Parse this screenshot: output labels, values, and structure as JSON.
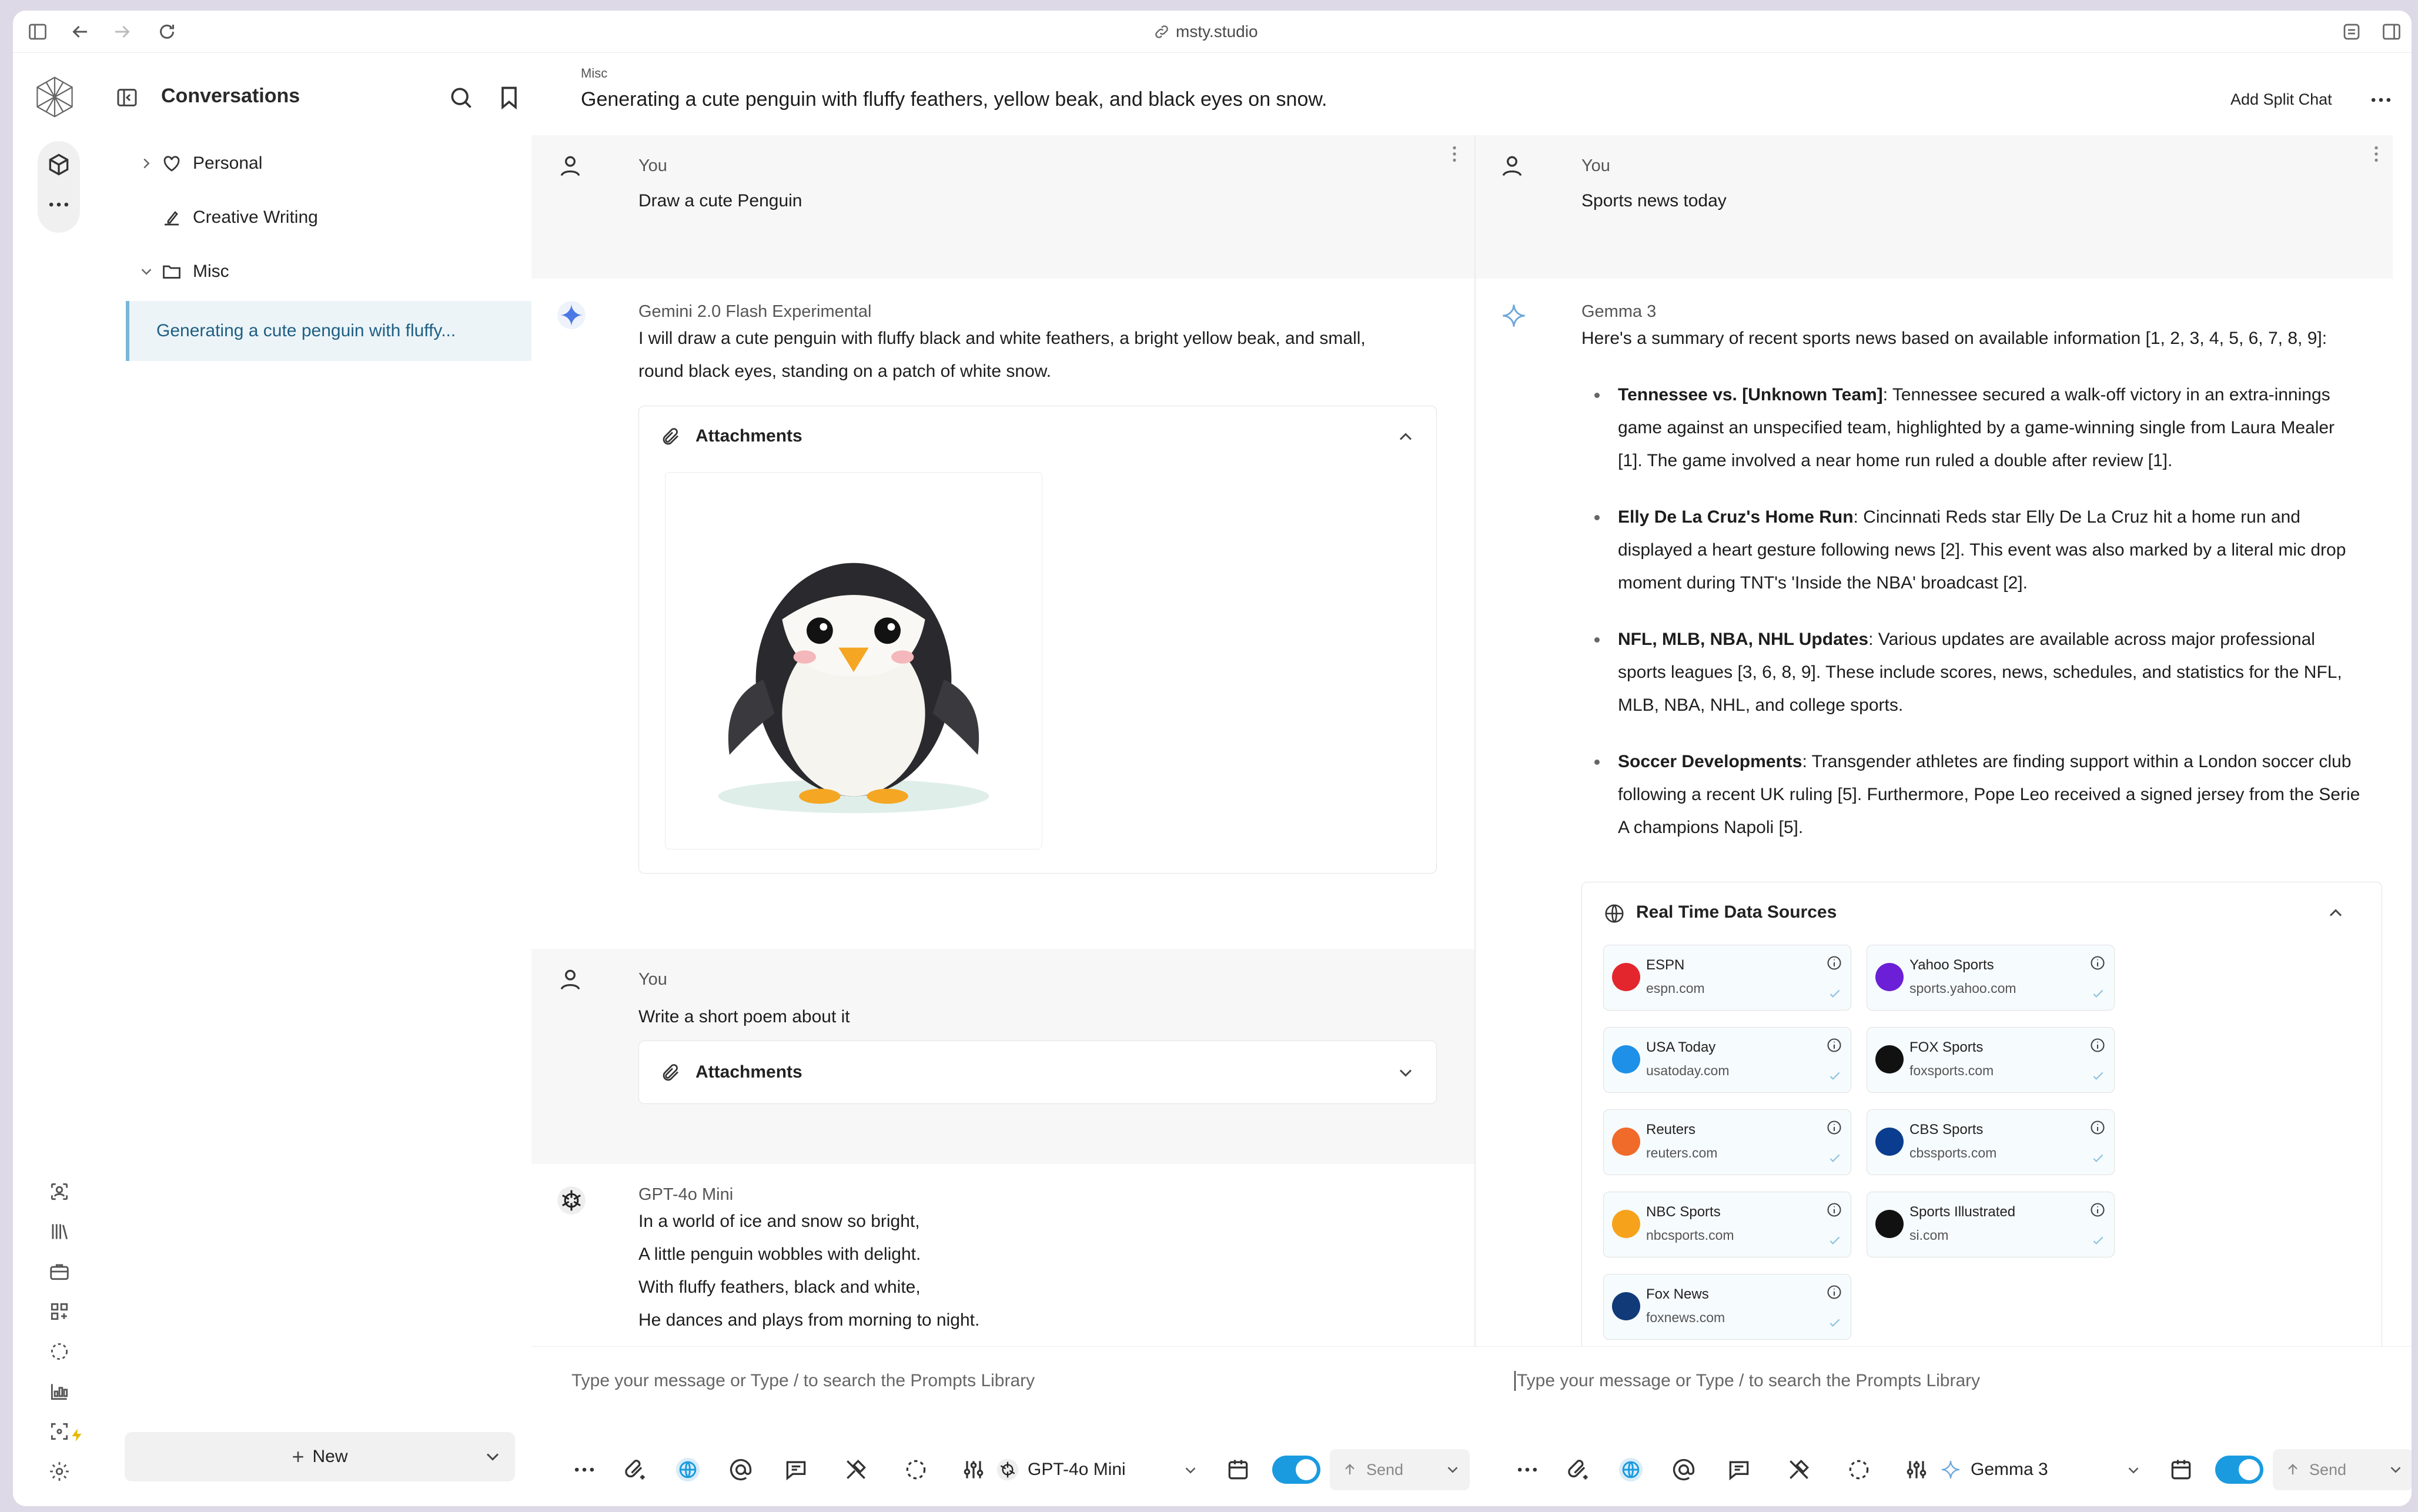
{
  "browser": {
    "url": "msty.studio"
  },
  "sidebar": {
    "title": "Conversations",
    "folders": [
      {
        "label": "Personal"
      },
      {
        "label": "Creative Writing"
      },
      {
        "label": "Misc"
      }
    ],
    "active_conversation": "Generating a cute penguin with fluffy...",
    "new_label": "New"
  },
  "header": {
    "folder": "Misc",
    "title": "Generating a cute penguin with fluffy feathers, yellow beak, and black eyes on snow.",
    "add_split": "Add Split Chat"
  },
  "left_chat": {
    "messages": [
      {
        "sender": "You",
        "text": "Draw a cute Penguin"
      },
      {
        "sender": "Gemini 2.0 Flash Experimental",
        "line1": "I will draw a cute penguin with fluffy black and white feathers, a bright yellow beak, and small,",
        "line2": "round black eyes, standing on a patch of white snow.",
        "attachments": "Attachments"
      },
      {
        "sender": "You",
        "text": "Write a short poem about it",
        "attachments": "Attachments"
      },
      {
        "sender": "GPT-4o Mini",
        "lines": [
          "In a world of ice and snow so bright,",
          "A little penguin wobbles with delight.",
          "With fluffy feathers, black and white,",
          "He dances and plays from morning to night."
        ]
      }
    ],
    "input_placeholder": "Type your message or Type / to search the Prompts Library",
    "model": "GPT-4o Mini",
    "send": "Send"
  },
  "right_chat": {
    "messages": [
      {
        "sender": "You",
        "text": "Sports news today"
      },
      {
        "sender": "Gemma 3",
        "intro": "Here's a summary of recent sports news based on available information [1, 2, 3, 4, 5, 6, 7, 8, 9]:"
      }
    ],
    "bullets": [
      {
        "bold": "Tennessee vs. [Unknown Team]",
        "rest": ": Tennessee secured a walk-off victory in an extra-innings game against an unspecified team, highlighted by a game-winning single from Laura Mealer [1]. The game involved a near home run ruled a double after review [1]."
      },
      {
        "bold": "Elly De La Cruz's Home Run",
        "rest": ": Cincinnati Reds star Elly De La Cruz hit a home run and displayed a heart gesture following news [2]. This event was also marked by a literal mic drop moment during TNT's 'Inside the NBA' broadcast [2]."
      },
      {
        "bold": "NFL, MLB, NBA, NHL Updates",
        "rest": ": Various updates are available across major professional sports leagues [3, 6, 8, 9]. These include scores, news, schedules, and statistics for the NFL, MLB, NBA, NHL, and college sports."
      },
      {
        "bold": "Soccer Developments",
        "rest": ": Transgender athletes are finding support within a London soccer club following a recent UK ruling [5]. Furthermore, Pope Leo received a signed jersey from the Serie A champions Napoli [5]."
      }
    ],
    "sources_title": "Real Time Data Sources",
    "sources": [
      {
        "name": "ESPN",
        "domain": "espn.com",
        "color": "#e3262d"
      },
      {
        "name": "Yahoo Sports",
        "domain": "sports.yahoo.com",
        "color": "#6b1fd6"
      },
      {
        "name": "USA Today",
        "domain": "usatoday.com",
        "color": "#1e90e8"
      },
      {
        "name": "FOX Sports",
        "domain": "foxsports.com",
        "color": "#111111"
      },
      {
        "name": "Reuters",
        "domain": "reuters.com",
        "color": "#f06a2a"
      },
      {
        "name": "CBS Sports",
        "domain": "cbssports.com",
        "color": "#0a3d8f"
      },
      {
        "name": "NBC Sports",
        "domain": "nbcsports.com",
        "color": "#f7a21b"
      },
      {
        "name": "Sports Illustrated",
        "domain": "si.com",
        "color": "#111111"
      },
      {
        "name": "Fox News",
        "domain": "foxnews.com",
        "color": "#103a78"
      }
    ],
    "input_placeholder": "Type your message or Type / to search the Prompts Library",
    "model": "Gemma 3",
    "send": "Send"
  },
  "colors": {
    "accent": "#1a9be0",
    "selected_bg": "#ecf4f8",
    "selected_text": "#1f5f83"
  }
}
